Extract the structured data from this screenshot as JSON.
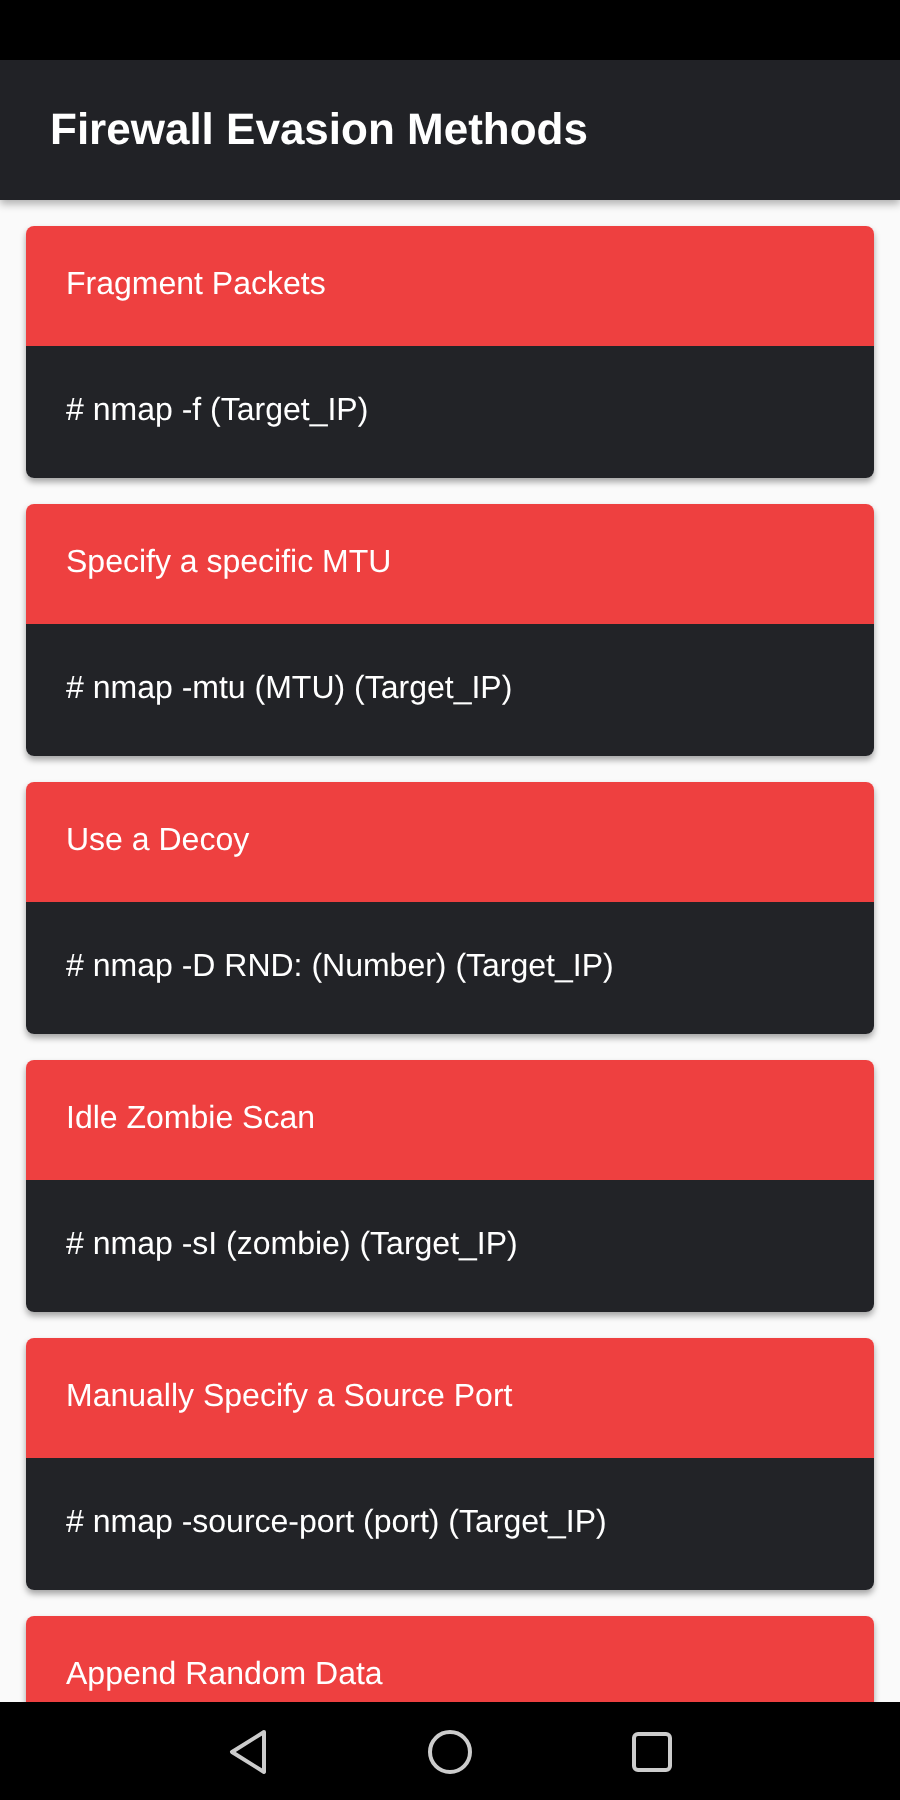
{
  "app_bar": {
    "title": "Firewall Evasion Methods"
  },
  "cards": [
    {
      "title": "Fragment Packets",
      "command": "# nmap -f (Target_IP)"
    },
    {
      "title": "Specify a specific MTU",
      "command": "# nmap -mtu (MTU) (Target_IP)"
    },
    {
      "title": "Use a Decoy",
      "command": "# nmap -D RND: (Number) (Target_IP)"
    },
    {
      "title": "Idle Zombie Scan",
      "command": "# nmap -sI (zombie) (Target_IP)"
    },
    {
      "title": "Manually Specify a Source Port",
      "command": "# nmap -source-port (port) (Target_IP)"
    },
    {
      "title": "Append Random Data"
    }
  ]
}
